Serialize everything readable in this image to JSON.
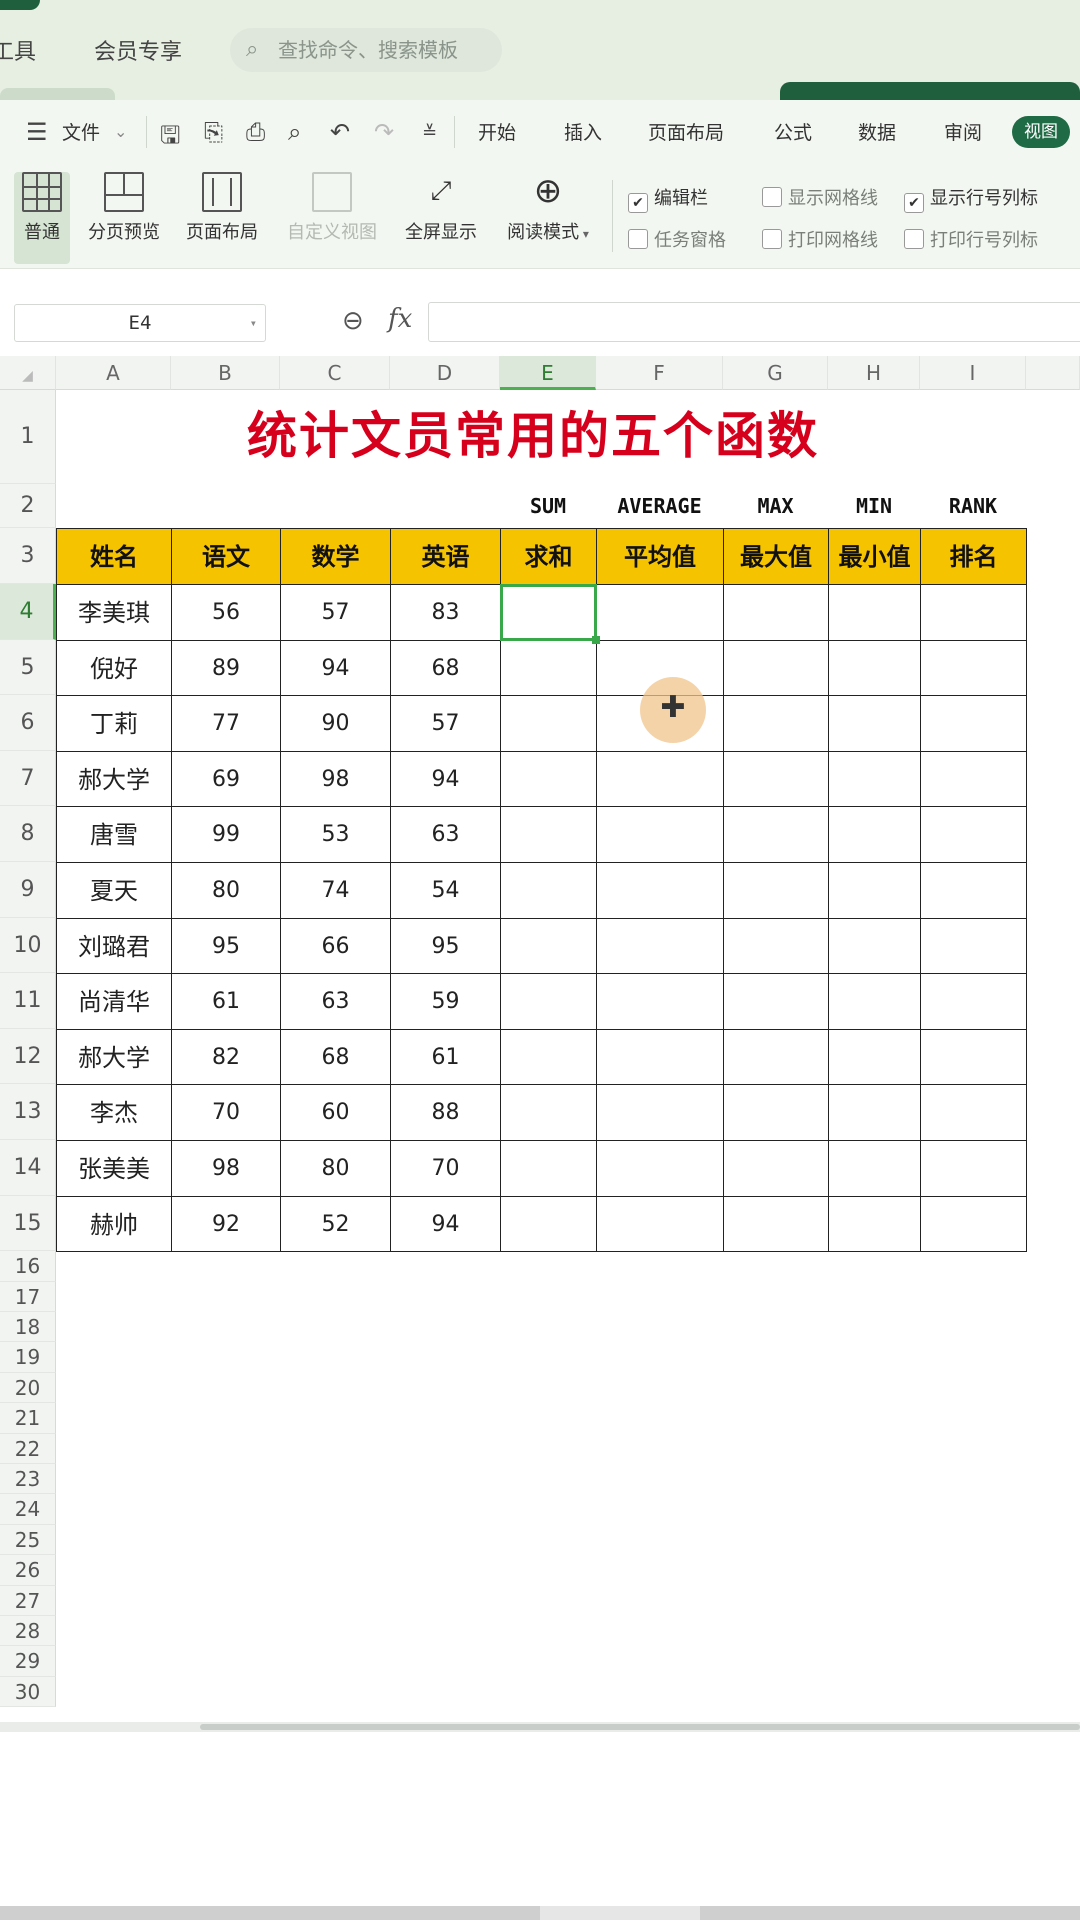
{
  "topbar": {
    "menu": [
      "工具",
      "会员专享"
    ],
    "search_placeholder": "查找命令、搜索模板"
  },
  "ribbon_tabs": {
    "file_label": "文件",
    "tabs": [
      "开始",
      "插入",
      "页面布局",
      "公式",
      "数据",
      "审阅"
    ],
    "active_tab": "视图"
  },
  "view_ribbon": {
    "buttons": [
      {
        "label": "普通",
        "icon": "grid-icon",
        "selected": true,
        "disabled": false
      },
      {
        "label": "分页预览",
        "icon": "page-break-icon",
        "selected": false,
        "disabled": false
      },
      {
        "label": "页面布局",
        "icon": "page-layout-icon",
        "selected": false,
        "disabled": false
      },
      {
        "label": "自定义视图",
        "icon": "custom-view-icon",
        "selected": false,
        "disabled": true
      },
      {
        "label": "全屏显示",
        "icon": "fullscreen-icon",
        "selected": false,
        "disabled": false
      },
      {
        "label": "阅读模式",
        "icon": "reading-mode-icon",
        "selected": false,
        "disabled": false
      }
    ],
    "checkboxes": [
      {
        "label": "编辑栏",
        "checked": true
      },
      {
        "label": "任务窗格",
        "checked": false
      },
      {
        "label": "显示网格线",
        "checked": false
      },
      {
        "label": "打印网格线",
        "checked": false
      },
      {
        "label": "显示行号列标",
        "checked": true
      },
      {
        "label": "打印行号列标",
        "checked": false
      }
    ]
  },
  "formula_bar": {
    "name_box": "E4",
    "fx_label": "fx",
    "formula": ""
  },
  "sheet": {
    "columns": [
      "A",
      "B",
      "C",
      "D",
      "E",
      "F",
      "G",
      "H",
      "I"
    ],
    "active_column": "E",
    "active_row": 4,
    "title": "统计文员常用的五个函数",
    "function_names": [
      "SUM",
      "AVERAGE",
      "MAX",
      "MIN",
      "RANK"
    ],
    "headers": [
      "姓名",
      "语文",
      "数学",
      "英语",
      "求和",
      "平均值",
      "最大值",
      "最小值",
      "排名"
    ],
    "rows": [
      [
        "李美琪",
        "56",
        "57",
        "83"
      ],
      [
        "倪好",
        "89",
        "94",
        "68"
      ],
      [
        "丁莉",
        "77",
        "90",
        "57"
      ],
      [
        "郝大学",
        "69",
        "98",
        "94"
      ],
      [
        "唐雪",
        "99",
        "53",
        "63"
      ],
      [
        "夏天",
        "80",
        "74",
        "54"
      ],
      [
        "刘璐君",
        "95",
        "66",
        "95"
      ],
      [
        "尚清华",
        "61",
        "63",
        "59"
      ],
      [
        "郝大学",
        "82",
        "68",
        "61"
      ],
      [
        "李杰",
        "70",
        "60",
        "88"
      ],
      [
        "张美美",
        "98",
        "80",
        "70"
      ],
      [
        "赫帅",
        "92",
        "52",
        "94"
      ]
    ],
    "row_numbers": [
      "1",
      "2",
      "3",
      "4",
      "5",
      "6",
      "7",
      "8",
      "9",
      "10",
      "11",
      "12",
      "13",
      "14",
      "15",
      "16",
      "17",
      "18",
      "19",
      "20",
      "21",
      "22",
      "23",
      "24",
      "25",
      "26",
      "27",
      "28",
      "29",
      "30"
    ]
  },
  "colors": {
    "accent_green": "#1f6b45",
    "header_fill": "#f6c300",
    "title_red": "#d6001c",
    "selection": "#38a84a"
  }
}
